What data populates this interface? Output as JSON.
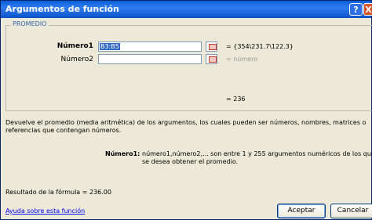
{
  "window": {
    "title": "Argumentos de función",
    "help_glyph": "?",
    "close_glyph": "X"
  },
  "group": {
    "label": "PROMEDIO"
  },
  "args": [
    {
      "label": "Número1",
      "value": "B3:B5",
      "result": "= {354\\231.7\\122.3}"
    },
    {
      "label": "Número2",
      "value": "",
      "result": "= número"
    }
  ],
  "result_line": "= 236",
  "description": "Devuelve el promedio (media aritmética) de los argumentos, los cuales pueden ser números, nombres, matrices o referencias que contengan números.",
  "arg_help": {
    "name": "Número1:",
    "text": "número1,número2,... son entre 1 y 255 argumentos numéricos de los que se desea obtener el promedio."
  },
  "formula_result": "Resultado de la fórmula =   236.00",
  "help_link": "Ayuda sobre esta función",
  "buttons": {
    "ok": "Aceptar",
    "cancel": "Cancelar"
  },
  "icons": {
    "collapse": "collapse-dialog-icon"
  }
}
